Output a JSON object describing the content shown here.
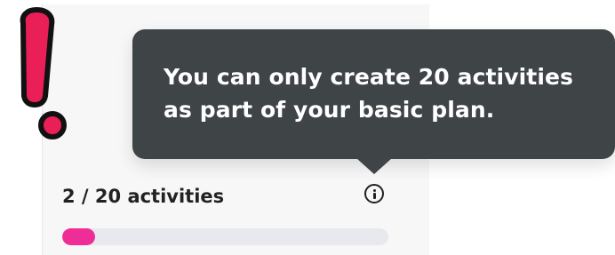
{
  "tooltip": {
    "message": "You can only create 20 activities as part of your basic plan."
  },
  "usage": {
    "label": "2 / 20 activities",
    "progress_fraction": 0.1
  },
  "icons": {
    "alert": "exclamation-icon",
    "info": "info-circle-icon"
  },
  "colors": {
    "tooltip_background": "#3f4447",
    "alert_red": "#ea1f57",
    "progress_fill": "#ef2d97",
    "progress_track": "#e7e9ee"
  }
}
